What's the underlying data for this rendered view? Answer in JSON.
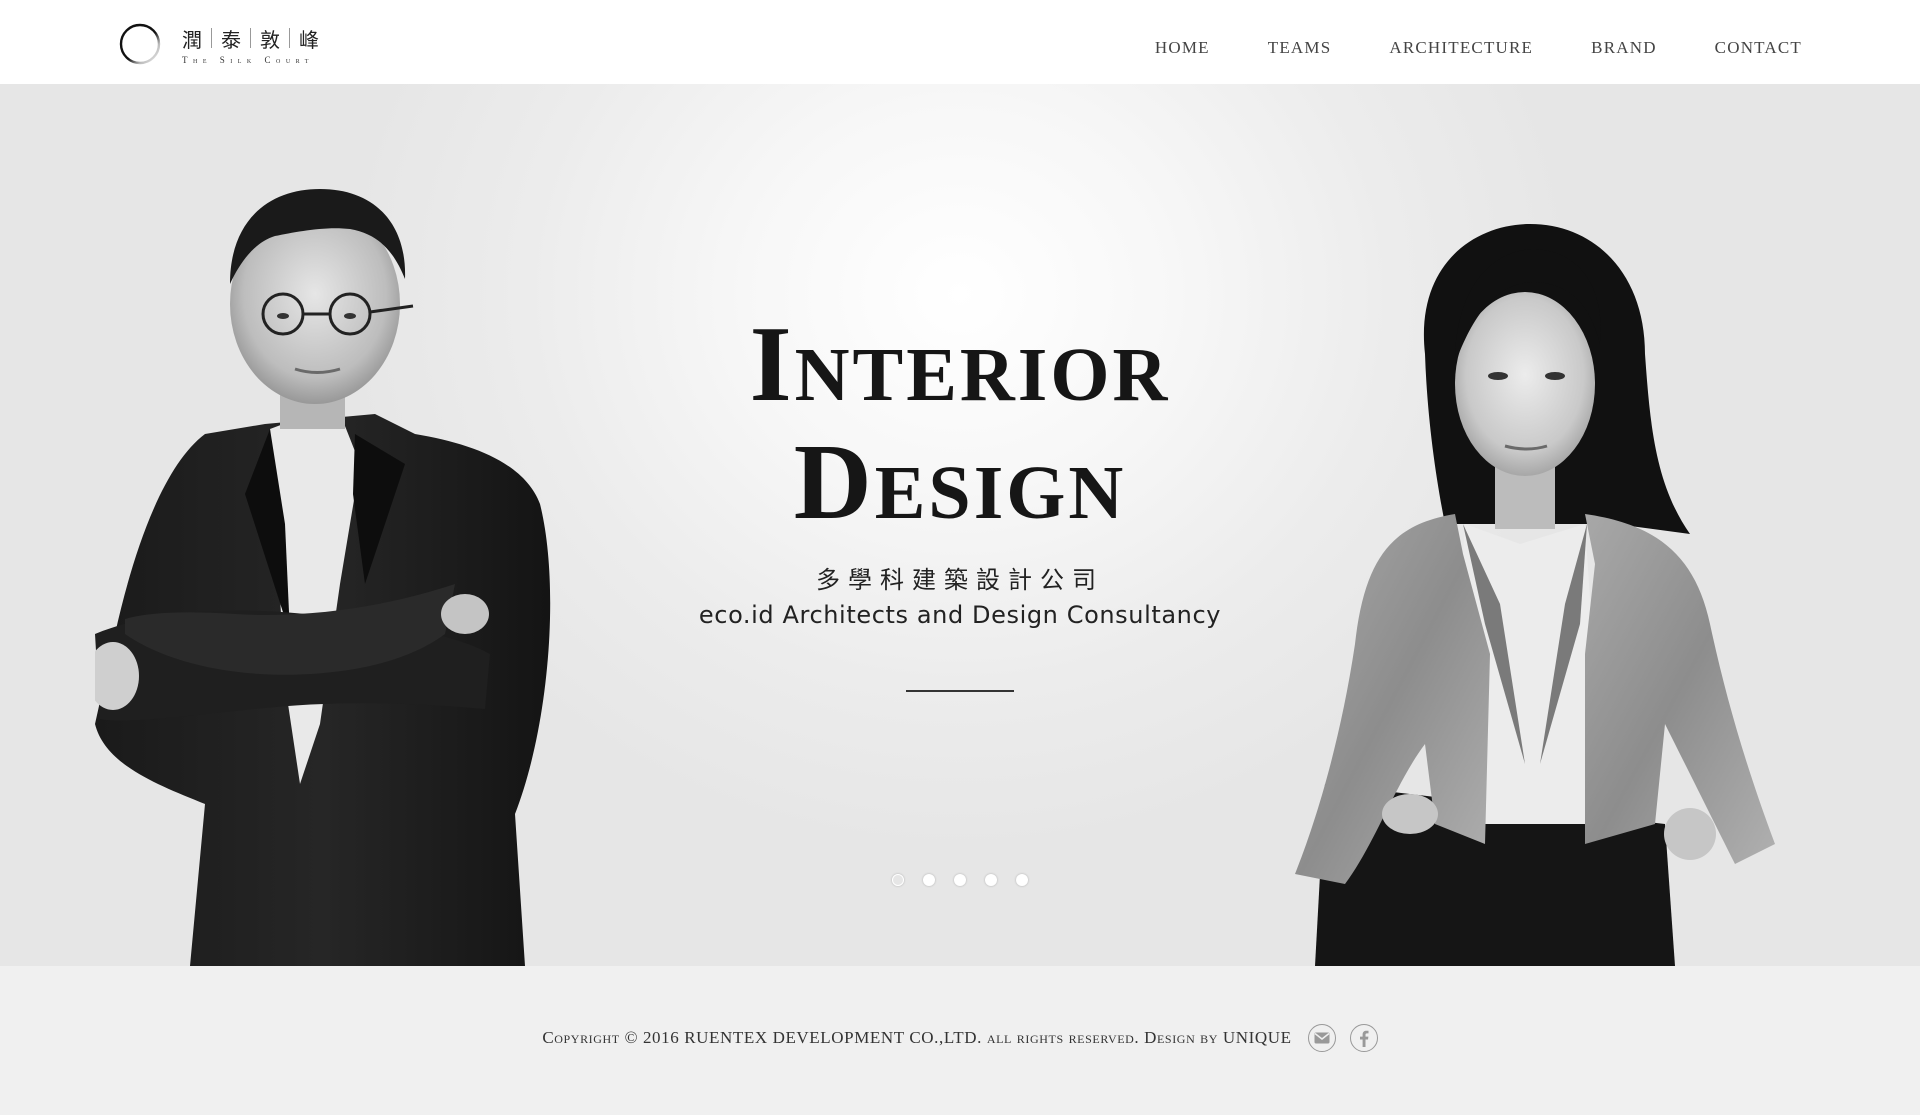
{
  "header": {
    "logo_cn": [
      "潤",
      "泰",
      "敦",
      "峰"
    ],
    "logo_en": "The Silk Court",
    "nav": [
      {
        "label": "HOME"
      },
      {
        "label": "TEAMS"
      },
      {
        "label": "ARCHITECTURE"
      },
      {
        "label": "BRAND"
      },
      {
        "label": "CONTACT"
      }
    ]
  },
  "hero": {
    "title_line1": "Interior",
    "title_line2": "Design",
    "subtitle_cn": "多學科建築設計公司",
    "subtitle_en": "eco.id Architects and Design Consultancy",
    "slides_total": 5,
    "active_slide": 1
  },
  "footer": {
    "copyright": "Copyright © 2016 RUENTEX DEVELOPMENT CO.,LTD. all rights reserved. Design by UNIQUE",
    "icons": [
      "mail-icon",
      "facebook-icon"
    ]
  },
  "colors": {
    "header_bg": "#ffffff",
    "footer_bg": "#f0f0f0",
    "text_dark": "#161616"
  }
}
